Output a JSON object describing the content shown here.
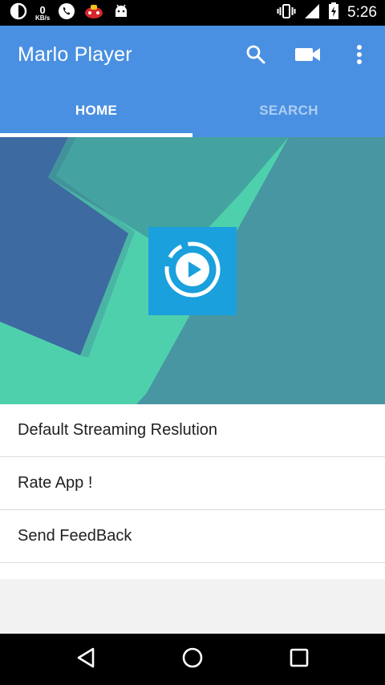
{
  "status_bar": {
    "net_speed_value": "0",
    "net_speed_unit": "KB/s",
    "time": "5:26"
  },
  "app": {
    "title": "Marlo Player",
    "accent_color": "#4a90e2",
    "actions": [
      "search-icon",
      "video-camera-icon",
      "more-vert-icon"
    ]
  },
  "tabs": [
    {
      "label": "HOME",
      "active": true
    },
    {
      "label": "SEARCH",
      "active": false
    }
  ],
  "banner": {
    "logo_color": "#1aa0dc",
    "colors": [
      "#3d6aa0",
      "#44a3a0",
      "#4fd0ad",
      "#4796a2"
    ]
  },
  "menu": {
    "items": [
      {
        "label": "Default Streaming Reslution"
      },
      {
        "label": "Rate App !"
      },
      {
        "label": "Send FeedBack"
      }
    ]
  },
  "nav": [
    "back-icon",
    "home-icon",
    "recents-icon"
  ]
}
